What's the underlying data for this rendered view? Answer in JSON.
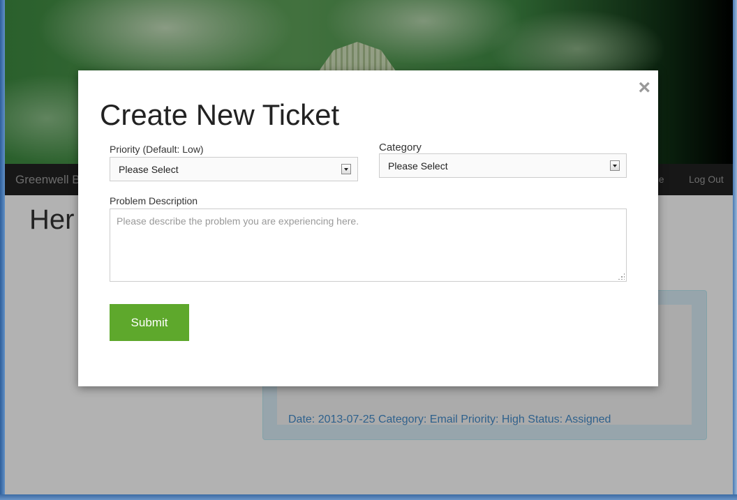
{
  "navbar": {
    "brand": "Greenwell B",
    "link_partial": "ne",
    "logout": "Log Out"
  },
  "content": {
    "title_partial": "Her",
    "ticket_summary": "Date: 2013-07-25 Category: Email Priority: High Status: Assigned"
  },
  "modal": {
    "close_glyph": "×",
    "title": "Create New Ticket",
    "priority": {
      "label": "Priority (Default: Low)",
      "value": "Please Select"
    },
    "category": {
      "label": "Category",
      "value": "Please Select"
    },
    "description": {
      "label": "Problem Description",
      "placeholder": "Please describe the problem you are experiencing here."
    },
    "submit_label": "Submit"
  },
  "colors": {
    "submit_bg": "#5ea82c",
    "navbar_bg": "#222222",
    "link_blue": "#428bca"
  }
}
